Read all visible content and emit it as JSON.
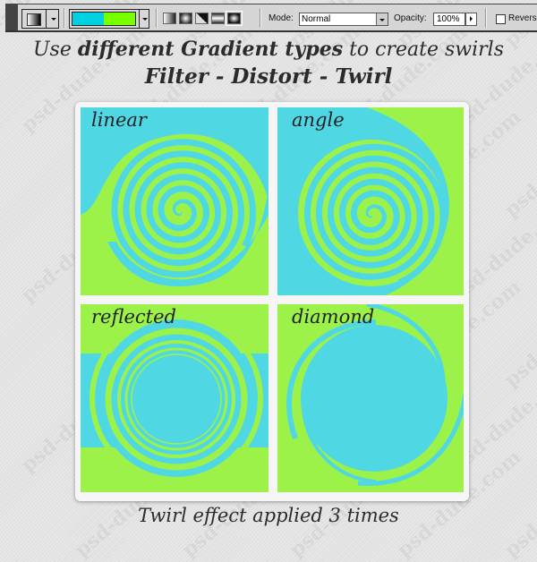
{
  "toolbar": {
    "preset_icon": "gradient-preset-icon",
    "gradient_colors": [
      "#00d0e0",
      "#78ff00"
    ],
    "gradient_types": [
      {
        "name": "linear-gradient-icon",
        "selected": false
      },
      {
        "name": "radial-gradient-icon",
        "selected": false
      },
      {
        "name": "angle-gradient-icon",
        "selected": false
      },
      {
        "name": "reflected-gradient-icon",
        "selected": false
      },
      {
        "name": "diamond-gradient-icon",
        "selected": true
      }
    ],
    "mode_label": "Mode:",
    "mode_value": "Normal",
    "opacity_label": "Opacity:",
    "opacity_value": "100%",
    "reverse_label": "Reverse",
    "reverse_checked": false
  },
  "heading": {
    "line1_pre": "Use ",
    "line1_bold": "different Gradient types",
    "line1_post": " to create swirls",
    "line2": "Filter - Distort - Twirl"
  },
  "panels": [
    {
      "label": "linear"
    },
    {
      "label": "angle"
    },
    {
      "label": "reflected"
    },
    {
      "label": "diamond"
    }
  ],
  "footer": "Twirl effect applied 3 times",
  "watermark": "psd-dude.com",
  "colors": {
    "cyan": "#4fd8e4",
    "green": "#9df24a"
  }
}
